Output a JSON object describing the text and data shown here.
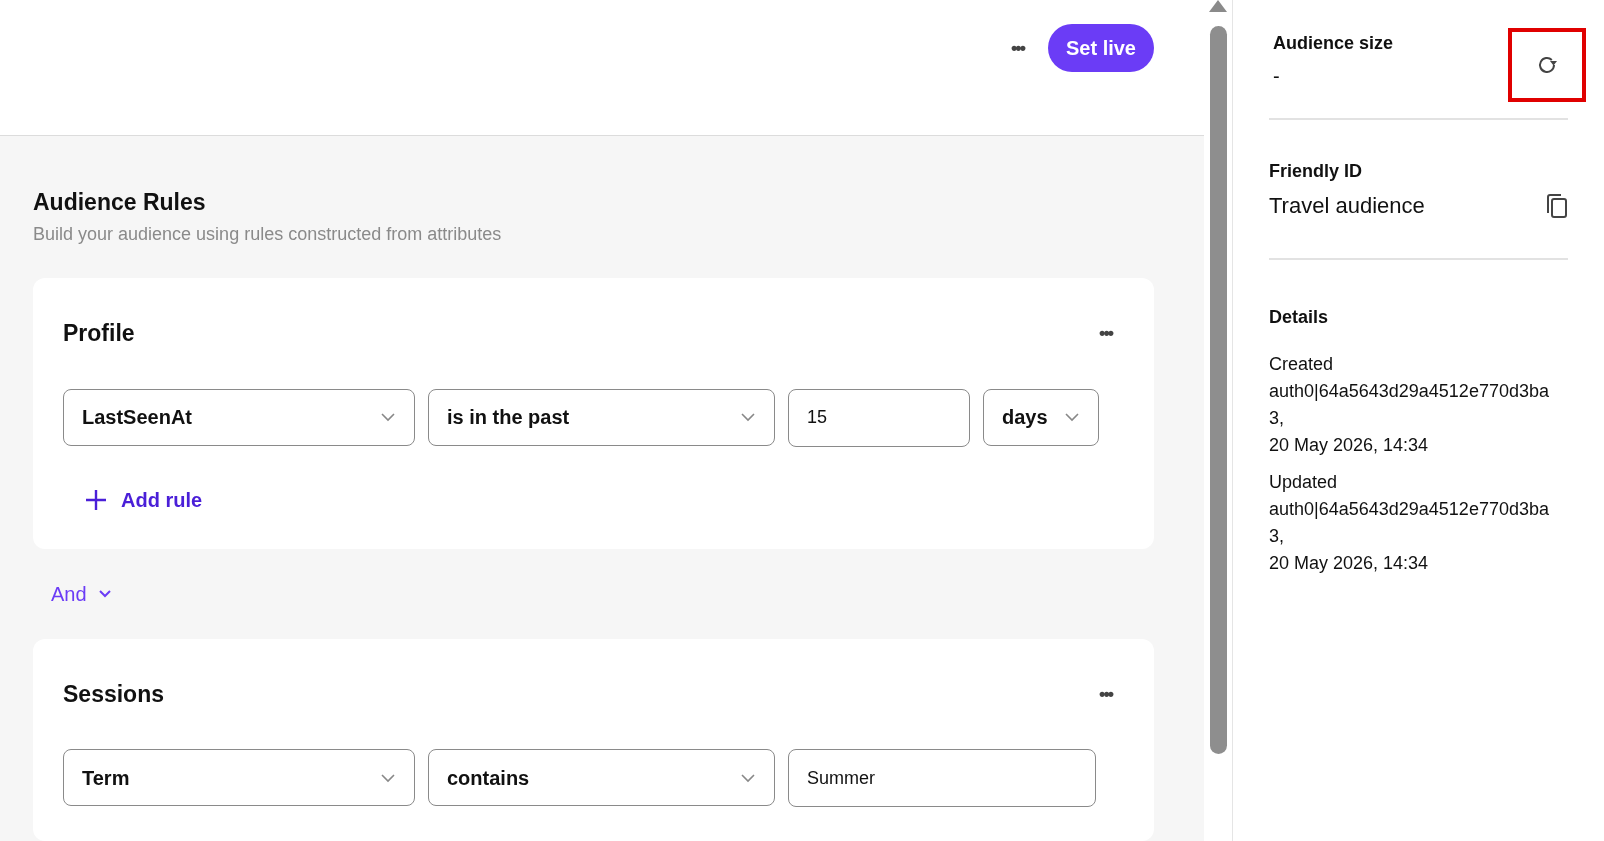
{
  "header": {
    "more_label": "•••",
    "primary_button": "Set live"
  },
  "rules_section": {
    "title": "Audience Rules",
    "subtitle": "Build your audience using rules constructed from attributes",
    "groups": [
      {
        "title": "Profile",
        "more_label": "•••",
        "rules": [
          [
            {
              "kind": "select",
              "value": "LastSeenAt"
            },
            {
              "kind": "select",
              "value": "is in the past"
            },
            {
              "kind": "input",
              "value": "15"
            },
            {
              "kind": "select",
              "value": "days"
            }
          ]
        ],
        "add_rule": "Add rule"
      },
      {
        "title": "Sessions",
        "more_label": "•••",
        "rules": [
          [
            {
              "kind": "select",
              "value": "Term"
            },
            {
              "kind": "select",
              "value": "contains"
            },
            {
              "kind": "input",
              "value": "Summer"
            }
          ]
        ]
      }
    ],
    "connectors": [
      "And"
    ]
  },
  "sidebar": {
    "audience_size": {
      "label": "Audience size",
      "value": "-",
      "refresh_highlighted": true
    },
    "friendly_id": {
      "label": "Friendly ID",
      "value": "Travel audience"
    },
    "details": {
      "title": "Details",
      "entries": [
        {
          "label": "Created",
          "lines": [
            "auth0|64a5643d29a4512e770d3ba",
            "3,",
            "20 May 2026, 14:34"
          ]
        },
        {
          "label": "Updated",
          "lines": [
            "auth0|64a5643d29a4512e770d3ba",
            "3,",
            "20 May 2026, 14:34"
          ]
        }
      ]
    }
  }
}
